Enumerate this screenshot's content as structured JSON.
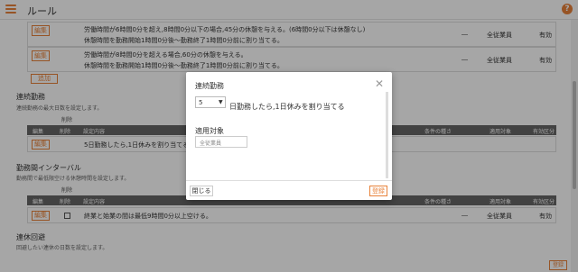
{
  "header": {
    "title": "ルール",
    "help": "?"
  },
  "rules": [
    {
      "edit": "編集",
      "line1": "労働時間が6時間0分を超え,8時間0分以下の場合,45分の休憩を与える。(6時間0分以下は休憩なし)",
      "line2": "休憩時間を勤務開始1時間0分後〜勤務終了1時間0分前に割り当てる。",
      "cond": "―",
      "target": "全従業員",
      "valid": "有効"
    },
    {
      "edit": "編集",
      "line1": "労働時間が8時間0分を超える場合,60分の休憩を与える。",
      "line2": "休憩時間を勤務開始1時間0分後〜勤務終了1時間0分前に割り当てる。",
      "cond": "―",
      "target": "全従業員",
      "valid": "有効"
    }
  ],
  "add_label": "追加",
  "consecutive": {
    "title": "連続勤務",
    "subtitle": "連続勤務の最大日数を設定します。",
    "delete_label": "削除",
    "headers": {
      "edit": "編集",
      "delete": "削除",
      "content": "設定内容",
      "cond": "条件の種さ",
      "target": "適用対象",
      "valid": "有効区分"
    },
    "row": {
      "edit": "編集",
      "desc": "5日勤務したら,1日休みを割り当てる"
    }
  },
  "interval": {
    "title": "勤務間インターバル",
    "subtitle": "勤務間で最低限空ける休憩時間を設定します。",
    "delete_label": "削除",
    "headers": {
      "edit": "編集",
      "delete": "削除",
      "content": "設定内容",
      "cond": "条件の種さ",
      "target": "適用対象",
      "valid": "有効区分"
    },
    "row": {
      "edit": "編集",
      "desc": "終業と始業の間は最低9時間0分以上空ける。",
      "cond": "―",
      "target": "全従業員",
      "valid": "有効"
    }
  },
  "avoid": {
    "title": "連休回避",
    "subtitle": "回避したい連休の日数を設定します。"
  },
  "bottom_save": "登録",
  "modal": {
    "title": "連続勤務",
    "select_value": "5",
    "days_text": "日勤務したら,1日休みを割り当てる",
    "target_label": "適用対象",
    "target_value": "全従業員",
    "close_label": "閉じる",
    "save_label": "登録"
  },
  "colors": {
    "accent": "#e8823a",
    "header_bg": "#666666"
  }
}
